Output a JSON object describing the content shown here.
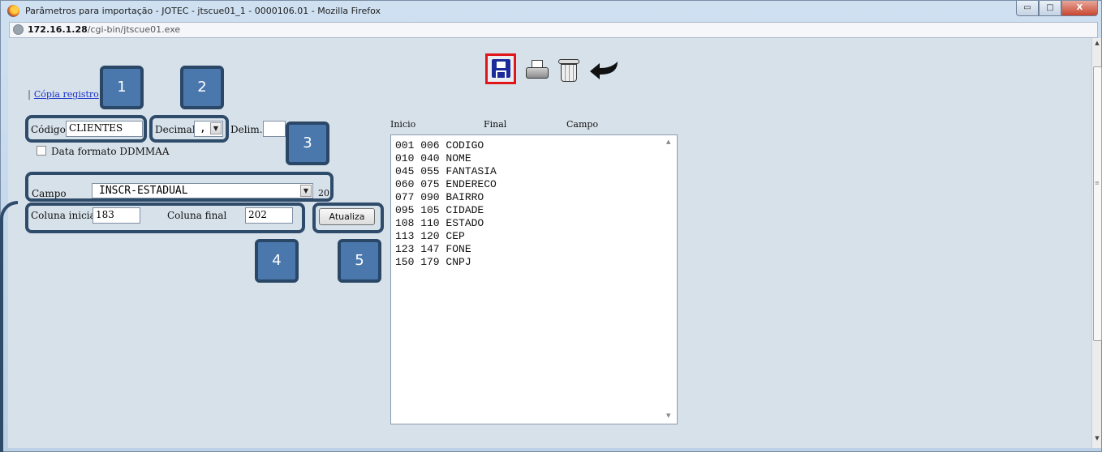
{
  "window": {
    "title": "Parâmetros para importação - JOTEC - jtscue01_1 - 0000106.01 - Mozilla Firefox",
    "controls": {
      "minimize": "▭",
      "maximize": "□",
      "close": "X"
    }
  },
  "address": {
    "host": "172.16.1.28",
    "path": "/cgi-bin/jtscue01.exe"
  },
  "toolbar": {
    "save_icon": "floppy-disk-icon",
    "print_icon": "printer-icon",
    "trash_icon": "trash-bin-icon",
    "back_icon": "return-arrow-icon",
    "highlight_color": "#e1161b"
  },
  "links": {
    "copia": "Cópia registro"
  },
  "form": {
    "codigo_label": "Código",
    "codigo_value": "CLIENTES",
    "decimal_label": "Decimal",
    "decimal_value": ",",
    "delim_label": "Delim.",
    "delim_value": "",
    "data_formato_label": "Data formato DDMMAA",
    "data_formato_checked": false,
    "campo_label": "Campo",
    "campo_value": "INSCR-ESTADUAL",
    "campo_size": "20",
    "coluna_inicial_label": "Coluna inicial",
    "coluna_inicial_value": "183",
    "coluna_final_label": "Coluna final",
    "coluna_final_value": "202",
    "atualiza_label": "Atualiza"
  },
  "list": {
    "headers": {
      "inicio": "Inicio",
      "final": "Final",
      "campo": "Campo"
    },
    "rows": [
      "001 006 CODIGO",
      "010 040 NOME",
      "045 055 FANTASIA",
      "060 075 ENDERECO",
      "077 090 BAIRRO",
      "095 105 CIDADE",
      "108 110 ESTADO",
      "113 120 CEP",
      "123 147 FONE",
      "150 179 CNPJ"
    ]
  },
  "callouts": [
    "1",
    "2",
    "3",
    "4",
    "5"
  ],
  "colors": {
    "callout_fill": "#4a78ad",
    "callout_border": "#2a4767",
    "page_bg": "#d7e1ea"
  }
}
